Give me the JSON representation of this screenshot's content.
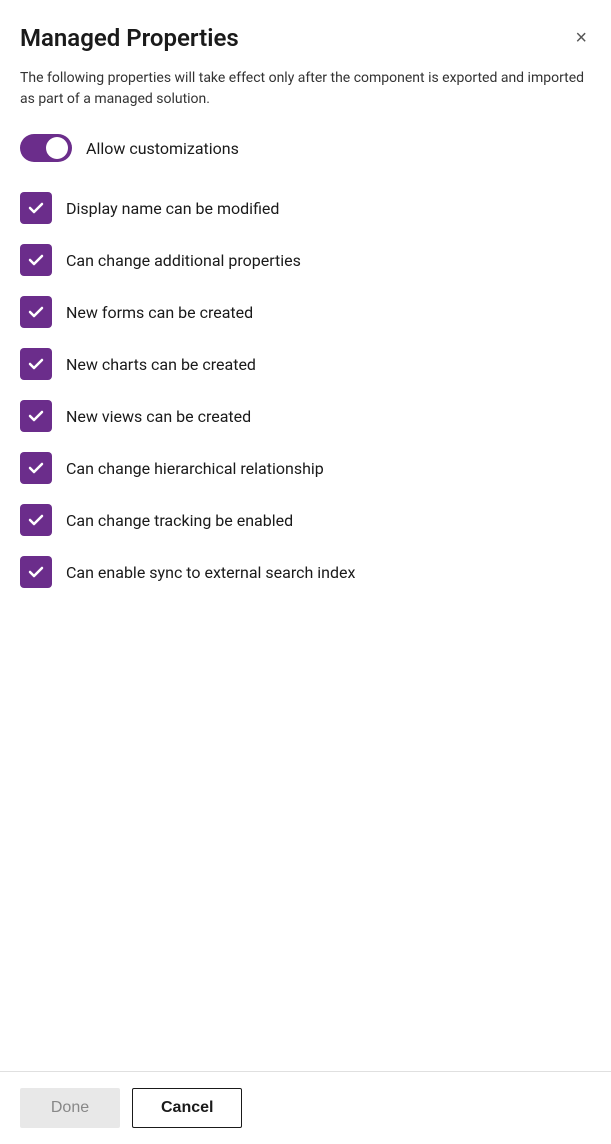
{
  "dialog": {
    "title": "Managed Properties",
    "description": "The following properties will take effect only after the component is exported and imported as part of a managed solution.",
    "close_label": "×"
  },
  "toggle": {
    "label": "Allow customizations",
    "checked": true
  },
  "checkboxes": [
    {
      "id": "display-name",
      "label": "Display name can be modified",
      "checked": true
    },
    {
      "id": "additional-props",
      "label": "Can change additional properties",
      "checked": true
    },
    {
      "id": "new-forms",
      "label": "New forms can be created",
      "checked": true
    },
    {
      "id": "new-charts",
      "label": "New charts can be created",
      "checked": true
    },
    {
      "id": "new-views",
      "label": "New views can be created",
      "checked": true
    },
    {
      "id": "hierarchical",
      "label": "Can change hierarchical relationship",
      "checked": true
    },
    {
      "id": "tracking",
      "label": "Can change tracking be enabled",
      "checked": true
    },
    {
      "id": "sync-search",
      "label": "Can enable sync to external search index",
      "checked": true
    }
  ],
  "footer": {
    "done_label": "Done",
    "cancel_label": "Cancel"
  }
}
